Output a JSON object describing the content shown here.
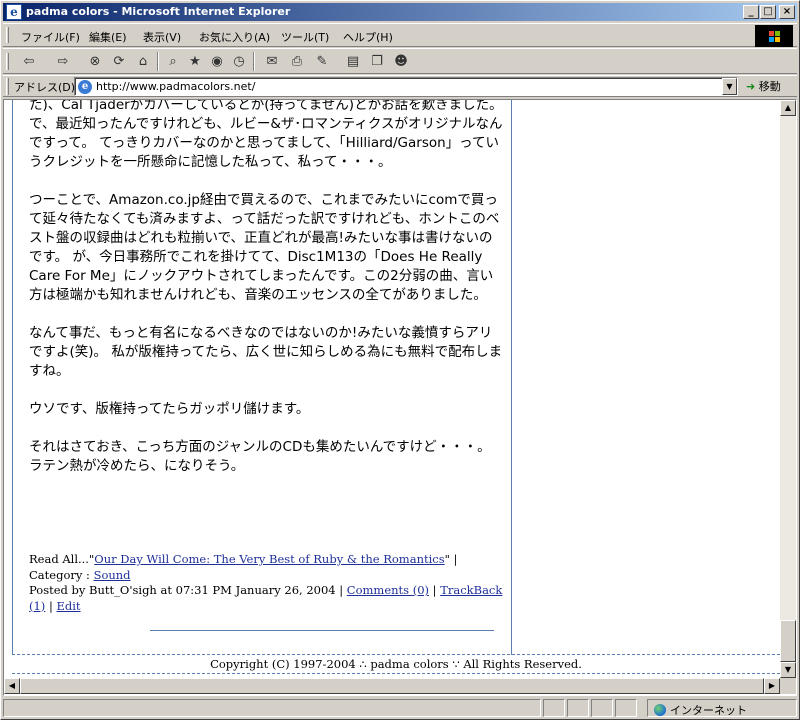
{
  "window": {
    "title": "padma colors - Microsoft Internet Explorer",
    "minimize": "_",
    "maximize": "□",
    "close": "×"
  },
  "menu": {
    "items": [
      "ファイル(F)",
      "編集(E)",
      "表示(V)",
      "お気に入り(A)",
      "ツール(T)",
      "ヘルプ(H)"
    ]
  },
  "toolbar": {
    "buttons": [
      {
        "icon": "back-arrow-icon",
        "glyph": "⇦"
      },
      {
        "icon": "forward-arrow-icon",
        "glyph": "⇨"
      },
      {
        "icon": "stop-icon",
        "glyph": "⊗"
      },
      {
        "icon": "refresh-icon",
        "glyph": "⟳"
      },
      {
        "icon": "home-icon",
        "glyph": "⌂"
      },
      {
        "icon": "search-icon",
        "glyph": "⌕"
      },
      {
        "icon": "favorites-icon",
        "glyph": "★"
      },
      {
        "icon": "media-icon",
        "glyph": "◉"
      },
      {
        "icon": "history-icon",
        "glyph": "◷"
      },
      {
        "icon": "mail-icon",
        "glyph": "✉"
      },
      {
        "icon": "print-icon",
        "glyph": "⎙"
      },
      {
        "icon": "edit-icon",
        "glyph": "✎"
      },
      {
        "icon": "discuss-icon",
        "glyph": "▤"
      },
      {
        "icon": "research-icon",
        "glyph": "❐"
      },
      {
        "icon": "messenger-icon",
        "glyph": "☻"
      }
    ]
  },
  "address": {
    "label": "アドレス(D)",
    "url": "http://www.padmacolors.net/",
    "go_label": "移動"
  },
  "post": {
    "paragraphs": [
      "た)、Cal Tjaderがカバーしているとか(持ってません)とかお話を歎きました。 で、最近知ったんですけれども、ルビー&ザ･ロマンティクスがオリジナルなんですって。 てっきりカバーなのかと思ってまして、「Hilliard/Garson」っていうクレジットを一所懸命に記憶した私って、私って・・・。",
      "つーことで、Amazon.co.jp経由で買えるので、これまでみたいにcomで買って延々待たなくても済みますよ、って話だった訳ですけれども、ホントこのベスト盤の収録曲はどれも粒揃いで、正直どれが最高!みたいな事は書けないのです。 が、今日事務所でこれを掛けてて、Disc1M13の「Does He Really Care For Me」にノックアウトされてしまったんです。この2分弱の曲、言い方は極端かも知れませんけれども、音楽のエッセンスの全てがありました。",
      "なんて事だ、もっと有名になるべきなのではないのか!みたいな義憤すらアリですよ(笑)。 私が版権持ってたら、広く世に知らしめる為にも無料で配布しますね。",
      "ウソです、版権持ってたらガッポリ儲けます。",
      "それはさておき、こっち方面のジャンルのCDも集めたいんですけど・・・。 ラテン熱が冷めたら、になりそう。"
    ]
  },
  "meta": {
    "read_all_prefix": "Read All...\"",
    "read_all_link": "Our Day Will Come: The Very Best of Ruby & the Romantics",
    "category_prefix": "\" | Category : ",
    "category": "Sound",
    "posted_by": "Posted by Butt_O'sigh at 07:31 PM January 26, 2004 | ",
    "comments": "Comments (0)",
    "sep": " | ",
    "trackback": "TrackBack (1)",
    "edit": "Edit"
  },
  "footer": {
    "text": "Copyright (C)   1997-2004   ∴ padma colors ∵   All Rights Reserved."
  },
  "status": {
    "zone": "インターネット"
  },
  "colors": {
    "title_start": "#0a246a",
    "title_end": "#a6caf0",
    "link": "#1f2f9a",
    "rule": "#5a7fb0"
  }
}
